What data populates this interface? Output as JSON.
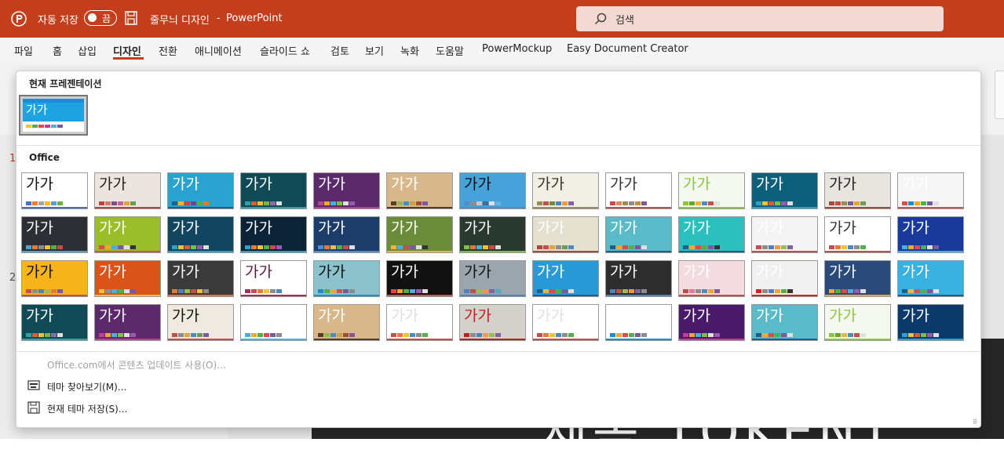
{
  "titlebar": {
    "autosave_label": "자동 저장",
    "toggle_state": "끔",
    "document_name": "줄무늬 디자인",
    "separator": "-",
    "app_name": "PowerPoint",
    "search_placeholder": "검색"
  },
  "ribbon_tabs": [
    {
      "label": "파일",
      "active": false
    },
    {
      "label": "홈",
      "active": false
    },
    {
      "label": "삽입",
      "active": false
    },
    {
      "label": "디자인",
      "active": true
    },
    {
      "label": "전환",
      "active": false
    },
    {
      "label": "애니메이션",
      "active": false
    },
    {
      "label": "슬라이드 쇼",
      "active": false
    },
    {
      "label": "검토",
      "active": false
    },
    {
      "label": "보기",
      "active": false
    },
    {
      "label": "녹화",
      "active": false
    },
    {
      "label": "도움말",
      "active": false
    },
    {
      "label": "PowerMockup",
      "active": false
    },
    {
      "label": "Easy Document Creator",
      "active": false
    }
  ],
  "slide_numbers": [
    "1",
    "2"
  ],
  "background_slide_text": "제목 TOKENT",
  "theme_gallery": {
    "current_section_title": "현재 프레젠테이션",
    "current_theme_sample": "가가",
    "office_section_title": "Office",
    "sample_text": "가가",
    "themes": [
      {
        "id": "office-theme",
        "bg": "#ffffff",
        "fg": "#111111",
        "sw": [
          "#4472c4",
          "#ed7d31",
          "#a5a5a5",
          "#ffc000",
          "#5b9bd5",
          "#70ad47"
        ]
      },
      {
        "id": "facet-warm",
        "bg": "#ece5df",
        "fg": "#222222",
        "sw": [
          "#b04b3c",
          "#d17c6a",
          "#7a4f8c",
          "#c75e9e",
          "#e0a53a",
          "#6a9a5c"
        ]
      },
      {
        "id": "ion-blue",
        "bg": "#29a2cf",
        "fg": "#ffffff",
        "sw": [
          "#1f5f8b",
          "#f4b61a",
          "#d93f3f",
          "#7a3ea1",
          "#52b04a",
          "#e67a1f"
        ]
      },
      {
        "id": "ion-teal",
        "bg": "#0f4a55",
        "fg": "#ffffff",
        "sw": [
          "#2ea1a1",
          "#d95f3b",
          "#f0c13a",
          "#7db347",
          "#8c6bb1",
          "#e0e0e0"
        ]
      },
      {
        "id": "purple",
        "bg": "#5a2a6a",
        "fg": "#ffffff",
        "sw": [
          "#c43e8a",
          "#f0a830",
          "#4ab0d9",
          "#7ac043",
          "#e0e0e0",
          "#9b59b6"
        ]
      },
      {
        "id": "wood-gallery",
        "bg": "#d8b88a",
        "fg": "#ffffff",
        "sw": [
          "#5a3b25",
          "#8fbc4a",
          "#4a8cbf",
          "#c9a340",
          "#a24d36",
          "#7a5a9c"
        ]
      },
      {
        "id": "pattern-blue",
        "bg": "#46a2d8",
        "fg": "#111111",
        "sw": [
          "#4b8ec9",
          "#8c8c8c",
          "#c7c7c7",
          "#3a6f9c",
          "#e0e0e0",
          "#6ab0e0"
        ]
      },
      {
        "id": "retrospect",
        "bg": "#f1efe4",
        "fg": "#333333",
        "sw": [
          "#9b8b4e",
          "#c0504d",
          "#6b8c3c",
          "#4f81bd",
          "#f79646",
          "#8064a2"
        ]
      },
      {
        "id": "slice",
        "bg": "#ffffff",
        "fg": "#333333",
        "sw": [
          "#c0504d",
          "#d98d5a",
          "#9b8b4e",
          "#8c8c8c",
          "#c48c3c",
          "#7a5a9c"
        ]
      },
      {
        "id": "green-leaf",
        "bg": "#f4f8ee",
        "fg": "#8cc63f",
        "sw": [
          "#8cc63f",
          "#6ba23a",
          "#f0b43a",
          "#4a8cbf",
          "#c0504d",
          "#e0e0e0"
        ]
      },
      {
        "id": "circuit",
        "bg": "#0e5f7a",
        "fg": "#ffffff",
        "sw": [
          "#2ea1c9",
          "#f0c13a",
          "#e05a3a",
          "#7ac043",
          "#9b59b6",
          "#e0e0e0"
        ]
      },
      {
        "id": "facet-light",
        "bg": "#e8e4e0",
        "fg": "#222222",
        "sw": [
          "#a64b3c",
          "#c0504d",
          "#9b8b4e",
          "#7a5a9c",
          "#e0a53a",
          "#6a9a5c"
        ]
      },
      {
        "id": "geometric",
        "bg": "#f6f6f6",
        "fg": "#ffffff",
        "sw": [
          "#e04a4a",
          "#1f8bc9",
          "#f0a830",
          "#52b04a",
          "#7a5a9c",
          "#e0e0e0"
        ]
      },
      {
        "id": "dark-slate",
        "bg": "#2c2f33",
        "fg": "#ffffff",
        "sw": [
          "#4fa0d6",
          "#e07b39",
          "#8c8c8c",
          "#f0c13a",
          "#52b04a",
          "#c0504d"
        ]
      },
      {
        "id": "lime",
        "bg": "#9cbd2a",
        "fg": "#ffffff",
        "sw": [
          "#e04a4a",
          "#f0a830",
          "#4ab0d9",
          "#7a5a9c",
          "#e0e0e0",
          "#333333"
        ]
      },
      {
        "id": "ion-dark",
        "bg": "#12465e",
        "fg": "#ffffff",
        "sw": [
          "#2ea1c9",
          "#f0c13a",
          "#e05a3a",
          "#7ac043",
          "#9b59b6",
          "#e0e0e0"
        ]
      },
      {
        "id": "mesh",
        "bg": "#0c2236",
        "fg": "#ffffff",
        "sw": [
          "#2ea1c9",
          "#e07b39",
          "#f0c13a",
          "#52b04a",
          "#c0504d",
          "#9b59b6"
        ]
      },
      {
        "id": "circuit-blue",
        "bg": "#1c3c6a",
        "fg": "#ffffff",
        "sw": [
          "#4b8ec9",
          "#e07b39",
          "#f0c13a",
          "#52b04a",
          "#c0504d",
          "#e0e0e0"
        ]
      },
      {
        "id": "gallery-green",
        "bg": "#6a8c3a",
        "fg": "#ffffff",
        "sw": [
          "#f0b43a",
          "#4ab0d9",
          "#c0504d",
          "#7a5a9c",
          "#e0e0e0",
          "#333333"
        ]
      },
      {
        "id": "badge",
        "bg": "#2a3a30",
        "fg": "#ffffff",
        "sw": [
          "#7ac043",
          "#e07b39",
          "#4ab0d9",
          "#f0c13a",
          "#c0504d",
          "#e0e0e0"
        ]
      },
      {
        "id": "parcel",
        "bg": "#e4e0d0",
        "fg": "#ffffff",
        "sw": [
          "#a64b3c",
          "#c0504d",
          "#e0a53a",
          "#8c8c8c",
          "#6a9a5c",
          "#4a8cbf"
        ]
      },
      {
        "id": "teal-mist",
        "bg": "#5bbac8",
        "fg": "#ffffff",
        "sw": [
          "#1f5f8b",
          "#f0a830",
          "#e04a4a",
          "#52b04a",
          "#7a5a9c",
          "#e0e0e0"
        ]
      },
      {
        "id": "teal",
        "bg": "#2bc0bd",
        "fg": "#ffffff",
        "sw": [
          "#1f5f8b",
          "#f0a830",
          "#e04a4a",
          "#52b04a",
          "#7a5a9c",
          "#333333"
        ]
      },
      {
        "id": "berlin-light",
        "bg": "#f4f4f4",
        "fg": "#ffffff",
        "sw": [
          "#c0504d",
          "#8c8c8c",
          "#4f81bd",
          "#f79646",
          "#9bbb59",
          "#8064a2"
        ]
      },
      {
        "id": "view",
        "bg": "#ffffff",
        "fg": "#333333",
        "sw": [
          "#c0504d",
          "#e07b39",
          "#f0c13a",
          "#4a8cbf",
          "#8c8c8c",
          "#52b04a"
        ]
      },
      {
        "id": "indigo",
        "bg": "#1a3a9a",
        "fg": "#ffffff",
        "sw": [
          "#4ab0d9",
          "#f0a830",
          "#e04a4a",
          "#52b04a",
          "#e0e0e0",
          "#7a5a9c"
        ]
      },
      {
        "id": "orange-circle",
        "bg": "#f4b41a",
        "fg": "#111111",
        "sw": [
          "#c0504d",
          "#8c8c8c",
          "#4f81bd",
          "#9bbb59",
          "#e07b39",
          "#7a5a9c"
        ]
      },
      {
        "id": "savon",
        "bg": "#d9541a",
        "fg": "#ffffff",
        "sw": [
          "#f0c13a",
          "#8c8c8c",
          "#4ab0d9",
          "#52b04a",
          "#e0e0e0",
          "#7a5a9c"
        ]
      },
      {
        "id": "dark-gray",
        "bg": "#3a3a3a",
        "fg": "#ffffff",
        "sw": [
          "#e07b39",
          "#4f81bd",
          "#9bbb59",
          "#c0504d",
          "#f0c13a",
          "#8c8c8c"
        ]
      },
      {
        "id": "quotable",
        "bg": "#ffffff",
        "fg": "#5a1a3a",
        "sw": [
          "#a2325a",
          "#c0504d",
          "#e07b39",
          "#f0c13a",
          "#8c8c8c",
          "#4a8cbf"
        ]
      },
      {
        "id": "frame-pattern",
        "bg": "#8cc2cc",
        "fg": "#111111",
        "sw": [
          "#1f8bc9",
          "#52b04a",
          "#f0a830",
          "#e04a4a",
          "#7a5a9c",
          "#8c8c8c"
        ]
      },
      {
        "id": "dark-wave",
        "bg": "#111111",
        "fg": "#ffffff",
        "sw": [
          "#e04a4a",
          "#f0a830",
          "#52b04a",
          "#4ab0d9",
          "#9b59b6",
          "#e0e0e0"
        ]
      },
      {
        "id": "steel",
        "bg": "#9aa5ad",
        "fg": "#111111",
        "sw": [
          "#4f81bd",
          "#c0504d",
          "#9bbb59",
          "#f79646",
          "#8064a2",
          "#4bacc6"
        ]
      },
      {
        "id": "ion-sky",
        "bg": "#2a9ad6",
        "fg": "#ffffff",
        "sw": [
          "#1f5f8b",
          "#f0b43a",
          "#e04a4a",
          "#52b04a",
          "#7a5a9c",
          "#e0e0e0"
        ]
      },
      {
        "id": "charcoal",
        "bg": "#2e2e2e",
        "fg": "#ffffff",
        "sw": [
          "#4f81bd",
          "#c0504d",
          "#9bbb59",
          "#f79646",
          "#8064a2",
          "#8c8c8c"
        ]
      },
      {
        "id": "pink-mosaic",
        "bg": "#f2dce0",
        "fg": "#ffffff",
        "sw": [
          "#c0504d",
          "#e07b9a",
          "#8c8c8c",
          "#4a8cbf",
          "#f0a830",
          "#7a5a9c"
        ]
      },
      {
        "id": "red-block",
        "bg": "#f0f0f0",
        "fg": "#ffffff",
        "sw": [
          "#e02020",
          "#8c8c8c",
          "#4f81bd",
          "#f0a830",
          "#52b04a",
          "#333333"
        ]
      },
      {
        "id": "splash",
        "bg": "#2a4a7a",
        "fg": "#ffffff",
        "sw": [
          "#f0a830",
          "#52b04a",
          "#e04a4a",
          "#4ab0d9",
          "#9b59b6",
          "#e0e0e0"
        ]
      },
      {
        "id": "ion-light",
        "bg": "#3ab0e0",
        "fg": "#ffffff",
        "sw": [
          "#1f5f8b",
          "#f0b43a",
          "#e04a4a",
          "#52b04a",
          "#7a5a9c",
          "#e0e0e0"
        ]
      },
      {
        "id": "ion-teal-2",
        "bg": "#0f4a55",
        "fg": "#ffffff",
        "sw": [
          "#2ea1a1",
          "#d95f3b",
          "#f0c13a",
          "#7db347",
          "#8c6bb1",
          "#e0e0e0"
        ]
      },
      {
        "id": "purple-2",
        "bg": "#5a2a6a",
        "fg": "#ffffff",
        "sw": [
          "#c43e8a",
          "#f0a830",
          "#4ab0d9",
          "#7ac043",
          "#e0e0e0",
          "#9b59b6"
        ]
      },
      {
        "id": "frame",
        "bg": "#efeae0",
        "fg": "#111111",
        "sw": [
          "#c0504d",
          "#8c8c8c",
          "#e0a53a",
          "#4a8cbf",
          "#6a9a5c",
          "#7a5a9c"
        ]
      },
      {
        "id": "wisp",
        "bg": "#ffffff",
        "fg": "#ffffff",
        "sw": [
          "#4ab0d9",
          "#f0a830",
          "#52b04a",
          "#e04a4a",
          "#7a5a9c",
          "#8c8c8c"
        ]
      },
      {
        "id": "wood-type",
        "bg": "#d8b88a",
        "fg": "#ffffff",
        "sw": [
          "#5a3b25",
          "#8fbc4a",
          "#4a8cbf",
          "#c9a340",
          "#a24d36",
          "#7a5a9c"
        ]
      },
      {
        "id": "blank-light",
        "bg": "#ffffff",
        "fg": "#e0e0e0",
        "sw": [
          "#c0504d",
          "#e07b39",
          "#f0c13a",
          "#4a8cbf",
          "#8c8c8c",
          "#52b04a"
        ]
      },
      {
        "id": "berlin",
        "bg": "#d4d0cc",
        "fg": "#c02020",
        "sw": [
          "#c02020",
          "#8c8c8c",
          "#4f81bd",
          "#f79646",
          "#9bbb59",
          "#8064a2"
        ]
      },
      {
        "id": "minimal",
        "bg": "#ffffff",
        "fg": "#e0e0e0",
        "sw": [
          "#c0504d",
          "#e07b39",
          "#f0c13a",
          "#4a8cbf",
          "#8c8c8c",
          "#52b04a"
        ]
      },
      {
        "id": "blue-band",
        "bg": "#ffffff",
        "fg": "#ffffff",
        "sw": [
          "#1f8bc9",
          "#f0a830",
          "#e04a4a",
          "#52b04a",
          "#7a5a9c",
          "#8c8c8c"
        ]
      },
      {
        "id": "purple-3",
        "bg": "#4a1a6a",
        "fg": "#ffffff",
        "sw": [
          "#c43e8a",
          "#f0a830",
          "#4ab0d9",
          "#7ac043",
          "#e0e0e0",
          "#9b59b6"
        ]
      },
      {
        "id": "teal-gray",
        "bg": "#5bbac8",
        "fg": "#ffffff",
        "sw": [
          "#1f5f8b",
          "#f0a830",
          "#e04a4a",
          "#52b04a",
          "#7a5a9c",
          "#e0e0e0"
        ]
      },
      {
        "id": "green-leaf-2",
        "bg": "#f4f8ee",
        "fg": "#8cc63f",
        "sw": [
          "#8cc63f",
          "#6ba23a",
          "#f0b43a",
          "#4a8cbf",
          "#c0504d",
          "#e0e0e0"
        ]
      },
      {
        "id": "ion-deep",
        "bg": "#0c3a6a",
        "fg": "#ffffff",
        "sw": [
          "#2ea1c9",
          "#f0c13a",
          "#e05a3a",
          "#7ac043",
          "#9b59b6",
          "#e0e0e0"
        ]
      }
    ]
  },
  "menu": {
    "office_update": "Office.com에서 콘텐츠 업데이트 사용(O)...",
    "browse_themes": "테마 찾아보기(M)...",
    "save_theme": "현재 테마 저장(S)..."
  },
  "colors": {
    "accent": "#c43e1c",
    "search_bg": "#f3d9d2"
  }
}
